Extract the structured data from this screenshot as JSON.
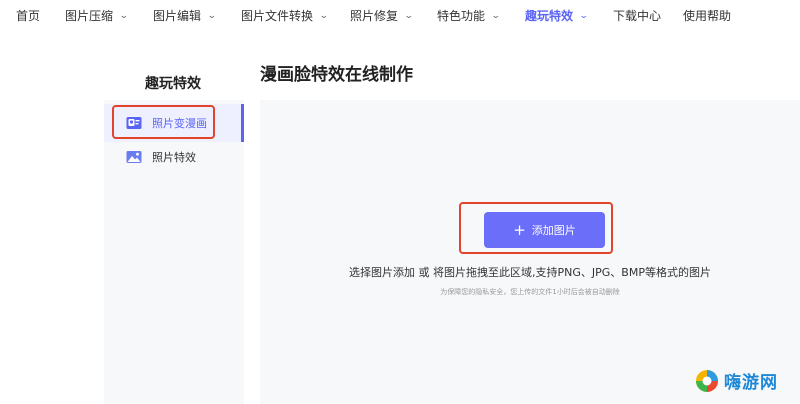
{
  "nav": {
    "items": [
      {
        "label": "首页",
        "dropdown": false,
        "active": false
      },
      {
        "label": "图片压缩",
        "dropdown": true,
        "active": false
      },
      {
        "label": "图片编辑",
        "dropdown": true,
        "active": false
      },
      {
        "label": "图片文件转换",
        "dropdown": true,
        "active": false
      },
      {
        "label": "照片修复",
        "dropdown": true,
        "active": false
      },
      {
        "label": "特色功能",
        "dropdown": true,
        "active": false
      },
      {
        "label": "趣玩特效",
        "dropdown": true,
        "active": true
      },
      {
        "label": "下载中心",
        "dropdown": false,
        "active": false
      },
      {
        "label": "使用帮助",
        "dropdown": false,
        "active": false
      }
    ],
    "accent_color": "#5b63f5"
  },
  "sidebar": {
    "title": "趣玩特效",
    "items": [
      {
        "label": "照片变漫画",
        "icon": "comic-photo-icon",
        "active": true
      },
      {
        "label": "照片特效",
        "icon": "landscape-photo-icon",
        "active": false
      }
    ]
  },
  "main": {
    "title": "漫画脸特效在线制作",
    "add_button_label": "添加图片",
    "hint": "选择图片添加 或 将图片拖拽至此区域,支持PNG、JPG、BMP等格式的图片",
    "privacy_note": "为保障您的隐私安全，您上传的文件1小时后会被自动删除",
    "button_color": "#6a6ef8",
    "highlight_color": "#e0452b"
  },
  "watermark": {
    "text": "嗨游网"
  }
}
